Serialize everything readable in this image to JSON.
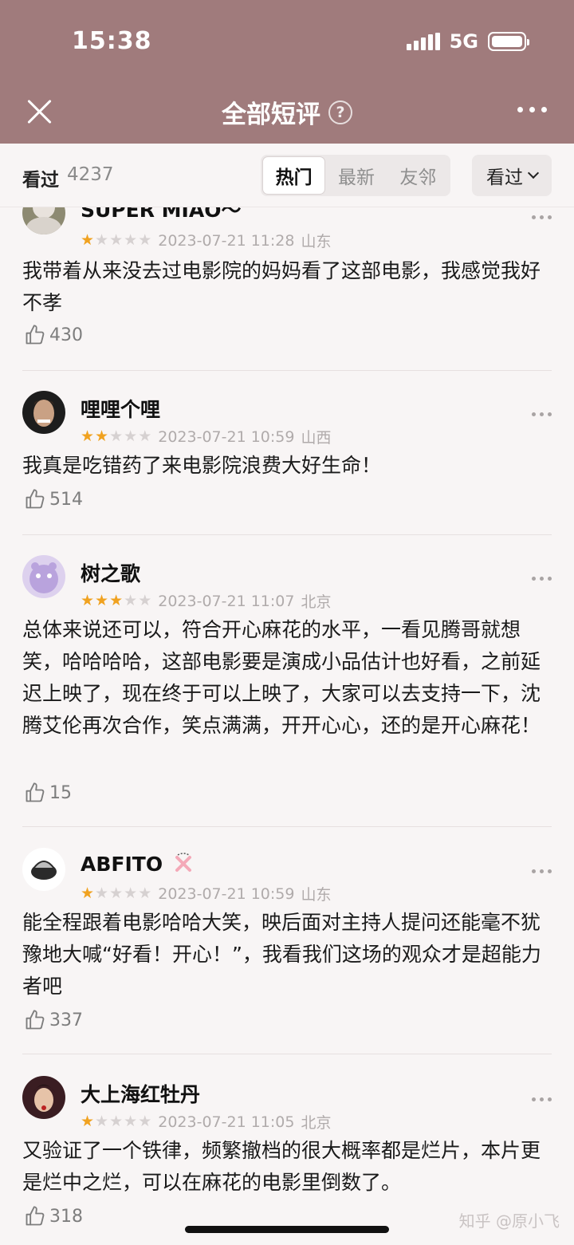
{
  "status": {
    "time": "15:38",
    "network": "5G"
  },
  "header": {
    "title": "全部短评",
    "help": "?"
  },
  "filter": {
    "seen_label": "看过",
    "seen_count": "4237",
    "tabs": [
      {
        "label": "热门"
      },
      {
        "label": "最新"
      },
      {
        "label": "友邻"
      }
    ],
    "dropdown": "看过"
  },
  "reviews": [
    {
      "user": "SUPER MIAO～",
      "rating": 1,
      "date": "2023-07-21 11:28",
      "location": "山东",
      "text": "我带着从来没去过电影院的妈妈看了这部电影，我感觉我好不孝",
      "likes": "430"
    },
    {
      "user": "哩哩个哩",
      "rating": 2,
      "date": "2023-07-21 10:59",
      "location": "山西",
      "text": "我真是吃错药了来电影院浪费大好生命！",
      "likes": "514"
    },
    {
      "user": "树之歌",
      "rating": 3,
      "date": "2023-07-21 11:07",
      "location": "北京",
      "text": "总体来说还可以，符合开心麻花的水平，一看见腾哥就想笑，哈哈哈哈，这部电影要是演成小品估计也好看，之前延迟上映了，现在终于可以上映了，大家可以去支持一下，沈腾艾伦再次合作，笑点满满，开开心心，还的是开心麻花！",
      "likes": "15"
    },
    {
      "user": "ABFITO",
      "rating": 1,
      "date": "2023-07-21 10:59",
      "location": "山东",
      "text": "能全程跟着电影哈哈大笑，映后面对主持人提问还能毫不犹豫地大喊“好看！开心！”，我看我们这场的观众才是超能力者吧",
      "likes": "337"
    },
    {
      "user": "大上海红牡丹",
      "rating": 1,
      "date": "2023-07-21 11:05",
      "location": "北京",
      "text": "又验证了一个铁律，频繁撤档的很大概率都是烂片，本片更是烂中之烂，可以在麻花的电影里倒数了。",
      "likes": "318"
    }
  ],
  "watermark": "知乎 @原小飞"
}
